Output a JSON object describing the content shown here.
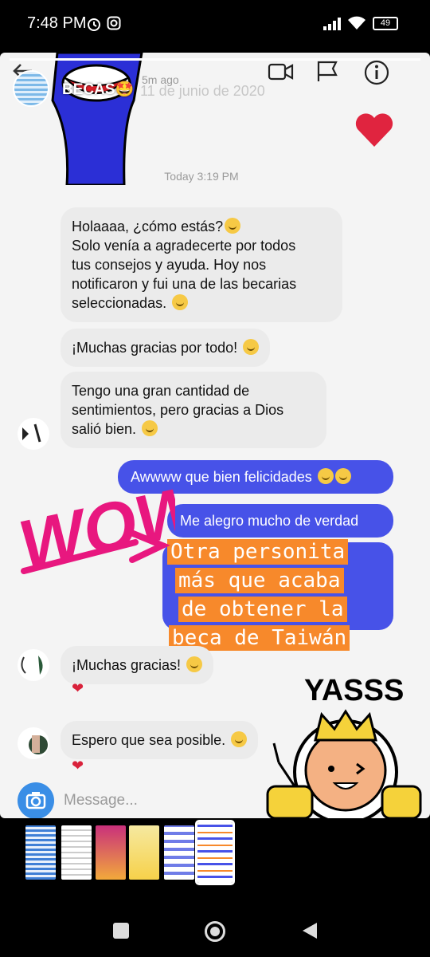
{
  "status_bar": {
    "time": "7:48 PM",
    "battery": "49"
  },
  "story": {
    "username": "BECAS🤩",
    "posted": "5m ago",
    "screenshot_date": "11 de junio de 2020",
    "icons": [
      "back-arrow-icon",
      "video-call-icon",
      "flag-icon",
      "info-icon"
    ]
  },
  "chat": {
    "day_label": "Today 3:19 PM",
    "incoming": [
      {
        "lines": [
          "Holaaaa, ¿cómo estás?",
          "Solo venía a agradecerte por todos",
          "tus consejos y ayuda. Hoy nos",
          "notificaron y fui una de las becarias",
          "seleccionadas."
        ]
      },
      {
        "lines": [
          "¡Muchas gracias por todo!"
        ]
      },
      {
        "lines": [
          "Tengo una gran cantidad de",
          "sentimientos, pero gracias a Dios",
          "salió bien."
        ]
      },
      {
        "lines": [
          "¡Muchas gracias!"
        ]
      },
      {
        "lines": [
          "Espero que sea posible."
        ]
      }
    ],
    "outgoing": [
      {
        "text": "Awwww que bien felicidades"
      },
      {
        "text": "Me alegro mucho de verdad"
      }
    ],
    "message_placeholder": "Message..."
  },
  "overlays": {
    "wow_sticker": "WOW",
    "caption_lines": [
      "Otra personita",
      "más que acaba",
      "de obtener la",
      "beca de Taiwán"
    ],
    "yasss_sticker": "YASSS"
  },
  "colors": {
    "outgoing_bubble": "#4752e8",
    "incoming_bubble": "#ebebeb",
    "caption_bg": "#f7892b",
    "wow": "#e8177f",
    "heart": "#e0243f"
  },
  "thumbnails_count": 6,
  "selected_thumbnail_index": 5
}
